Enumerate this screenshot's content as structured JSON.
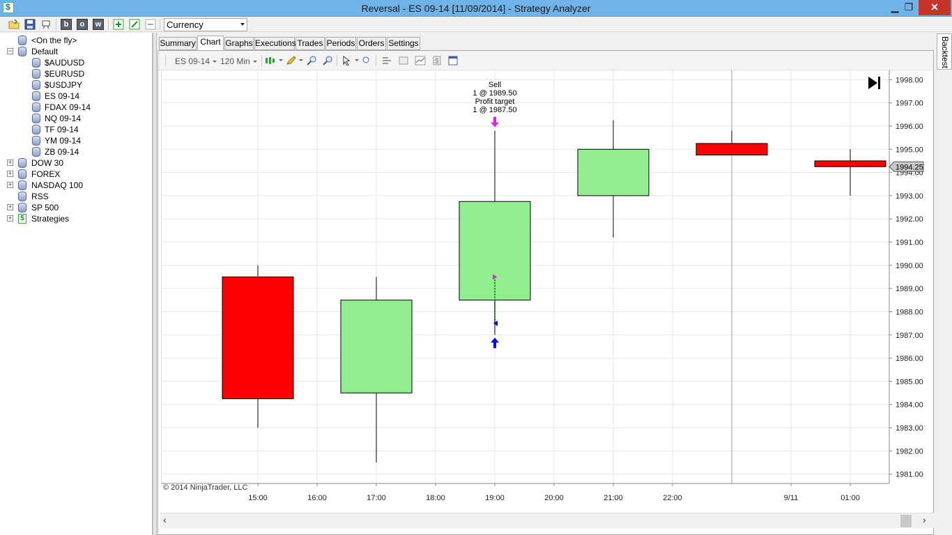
{
  "window": {
    "title": "Reversal - ES 09-14 [11/09/2014] - Strategy Analyzer",
    "minimize": "▁",
    "maximize": "❐",
    "close": "✕"
  },
  "toolbar": {
    "buttons": [
      "open-folder-icon",
      "save-icon",
      "clear-icon",
      "b",
      "o",
      "w",
      "add-icon",
      "edit-icon",
      "remove-icon"
    ],
    "b_label": "b",
    "o_label": "o",
    "w_label": "w",
    "currency_value": "Currency"
  },
  "tree": {
    "items": [
      {
        "label": "<On the fly>",
        "expander": "",
        "depth": 1
      },
      {
        "label": "Default",
        "expander": "−",
        "depth": 0
      },
      {
        "label": "$AUDUSD",
        "expander": "",
        "depth": 2
      },
      {
        "label": "$EURUSD",
        "expander": "",
        "depth": 2
      },
      {
        "label": "$USDJPY",
        "expander": "",
        "depth": 2
      },
      {
        "label": "ES 09-14",
        "expander": "",
        "depth": 2
      },
      {
        "label": "FDAX 09-14",
        "expander": "",
        "depth": 2
      },
      {
        "label": "NQ 09-14",
        "expander": "",
        "depth": 2
      },
      {
        "label": "TF 09-14",
        "expander": "",
        "depth": 2
      },
      {
        "label": "YM 09-14",
        "expander": "",
        "depth": 2
      },
      {
        "label": "ZB 09-14",
        "expander": "",
        "depth": 2
      },
      {
        "label": "DOW 30",
        "expander": "+",
        "depth": 0
      },
      {
        "label": "FOREX",
        "expander": "+",
        "depth": 0
      },
      {
        "label": "NASDAQ 100",
        "expander": "+",
        "depth": 0
      },
      {
        "label": "RSS",
        "expander": "",
        "depth": 1
      },
      {
        "label": "SP 500",
        "expander": "+",
        "depth": 0
      },
      {
        "label": "Strategies",
        "expander": "+",
        "depth": 0,
        "icon": "strategy"
      }
    ]
  },
  "tabs": [
    "Summary",
    "Chart",
    "Graphs",
    "Executions",
    "Trades",
    "Periods",
    "Orders",
    "Settings"
  ],
  "active_tab": "Chart",
  "side_tab": "Backtest",
  "chart_toolbar": {
    "instrument": "ES 09-14",
    "interval": "120 Min"
  },
  "chart_data": {
    "type": "candlestick",
    "copyright": "© 2014 NinjaTrader, LLC",
    "x_tick_labels": [
      "15:00",
      "16:00",
      "17:00",
      "18:00",
      "19:00",
      "20:00",
      "21:00",
      "22:00",
      "9/11",
      "01:00"
    ],
    "y_tick_labels": [
      "1981.00",
      "1982.00",
      "1983.00",
      "1984.00",
      "1985.00",
      "1986.00",
      "1987.00",
      "1988.00",
      "1989.00",
      "1990.00",
      "1991.00",
      "1992.00",
      "1993.00",
      "1994.00",
      "1995.00",
      "1996.00",
      "1997.00",
      "1998.00"
    ],
    "ylim": [
      1980.6,
      1998.4
    ],
    "candles": [
      {
        "time": "15:00",
        "open": 1989.5,
        "high": 1990.0,
        "low": 1983.0,
        "close": 1984.25,
        "color": "#ff0000"
      },
      {
        "time": "17:00",
        "open": 1984.5,
        "high": 1989.5,
        "low": 1981.5,
        "close": 1988.5,
        "color": "#90ee90"
      },
      {
        "time": "19:00",
        "open": 1988.5,
        "high": 1995.8,
        "low": 1987.0,
        "close": 1992.75,
        "color": "#90ee90"
      },
      {
        "time": "21:00",
        "open": 1993.0,
        "high": 1996.25,
        "low": 1991.2,
        "close": 1995.0,
        "color": "#90ee90"
      },
      {
        "time": "23:00",
        "open": 1995.25,
        "high": 1995.8,
        "low": 1994.75,
        "close": 1994.75,
        "color": "#ff0000"
      },
      {
        "time": "01:00",
        "open": 1994.5,
        "high": 1995.0,
        "low": 1993.0,
        "close": 1994.25,
        "color": "#ff0000"
      }
    ],
    "last_price_label": "1994.25",
    "trade_annotation": {
      "lines": [
        "Sell",
        "1 @ 1989.50",
        "Profit target",
        "1 @ 1987.50"
      ],
      "time": "19:00",
      "entry_price": 1987.5,
      "exit_price": 1989.5
    },
    "grid": true,
    "colors": {
      "up": "#90ee90",
      "down": "#ff0000",
      "sell_marker": "#e020e0",
      "buy_marker": "#0000ff",
      "trade_line": "#008000"
    }
  }
}
